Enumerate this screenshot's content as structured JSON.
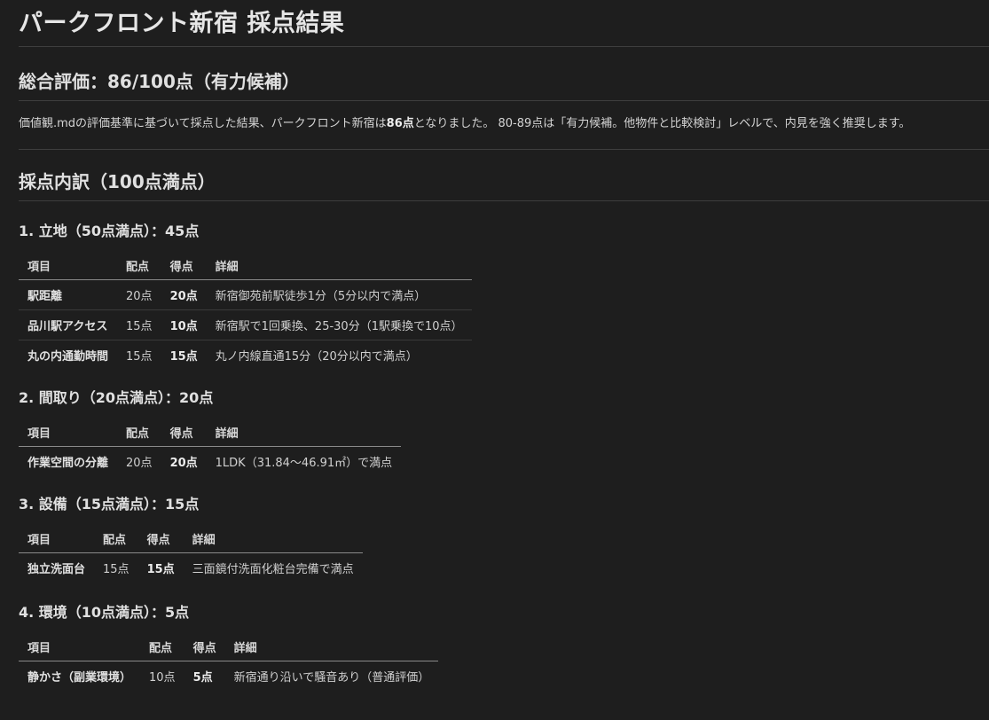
{
  "title": "パークフロント新宿 採点結果",
  "overall": {
    "heading": "総合評価：86/100点（有力候補）",
    "summary_pre": "価値観.mdの評価基準に基づいて採点した結果、パークフロント新宿は",
    "summary_score": "86点",
    "summary_post": "となりました。 80-89点は「有力候補。他物件と比較検討」レベルで、内見を強く推奨します。"
  },
  "breakdown": {
    "heading": "採点内訳（100点満点）",
    "sections": [
      {
        "heading": "1. 立地（50点満点）：45点",
        "columns": [
          "項目",
          "配点",
          "得点",
          "詳細"
        ],
        "rows": [
          {
            "item": "駅距離",
            "allot": "20点",
            "score": "20点",
            "detail": "新宿御苑前駅徒歩1分（5分以内で満点）"
          },
          {
            "item": "品川駅アクセス",
            "allot": "15点",
            "score": "10点",
            "detail": "新宿駅で1回乗換、25-30分（1駅乗換で10点）"
          },
          {
            "item": "丸の内通勤時間",
            "allot": "15点",
            "score": "15点",
            "detail": "丸ノ内線直通15分（20分以内で満点）"
          }
        ]
      },
      {
        "heading": "2. 間取り（20点満点）：20点",
        "columns": [
          "項目",
          "配点",
          "得点",
          "詳細"
        ],
        "rows": [
          {
            "item": "作業空間の分離",
            "allot": "20点",
            "score": "20点",
            "detail": "1LDK（31.84〜46.91㎡）で満点"
          }
        ]
      },
      {
        "heading": "3. 設備（15点満点）：15点",
        "columns": [
          "項目",
          "配点",
          "得点",
          "詳細"
        ],
        "rows": [
          {
            "item": "独立洗面台",
            "allot": "15点",
            "score": "15点",
            "detail": "三面鏡付洗面化粧台完備で満点"
          }
        ]
      },
      {
        "heading": "4. 環境（10点満点）：5点",
        "columns": [
          "項目",
          "配点",
          "得点",
          "詳細"
        ],
        "rows": [
          {
            "item": "静かさ（副業環境）",
            "allot": "10点",
            "score": "5点",
            "detail": "新宿通り沿いで騒音あり（普通評価）"
          }
        ]
      }
    ]
  }
}
